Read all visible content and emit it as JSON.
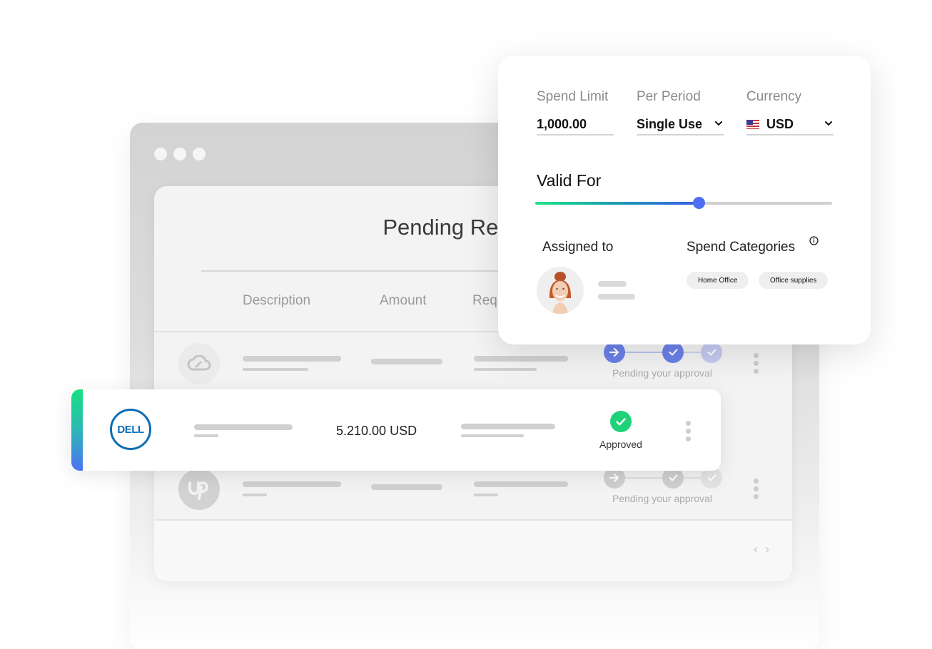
{
  "browser": {
    "window_controls": [
      "close",
      "minimize",
      "maximize"
    ]
  },
  "requests_card": {
    "title": "Pending Requests",
    "columns": [
      "Description",
      "Amount",
      "Requester"
    ],
    "rows": [
      {
        "vendor_icon": "creative-cloud-icon",
        "status": "Pending your approval",
        "steps": [
          "arrow-right",
          "check",
          "check"
        ]
      },
      {
        "vendor_icon": "upwork-icon",
        "status": "Pending your approval",
        "steps": [
          "arrow-right",
          "check",
          "check"
        ]
      }
    ],
    "pagination": {
      "prev": "‹",
      "next": "›"
    }
  },
  "highlighted_request": {
    "vendor": "DELL",
    "amount": "5.210.00 USD",
    "status": "Approved",
    "accent_gradient": [
      "#18e07f",
      "#4b73f5"
    ],
    "status_color": "#1ed27a"
  },
  "card_settings": {
    "spend_limit": {
      "label": "Spend Limit",
      "value": "1,000.00"
    },
    "per_period": {
      "label": "Per Period",
      "value": "Single Use"
    },
    "currency": {
      "label": "Currency",
      "value": "USD",
      "flag": "us-flag-icon"
    },
    "valid_for": {
      "label": "Valid For",
      "progress_percent": 55
    },
    "assigned_to": {
      "label": "Assigned to"
    },
    "spend_categories": {
      "label": "Spend Categories",
      "chips": [
        "Home Office",
        "Office supplies"
      ]
    },
    "colors": {
      "slider_thumb": "#4f6ff2",
      "step_active": "#6b80e8"
    }
  }
}
